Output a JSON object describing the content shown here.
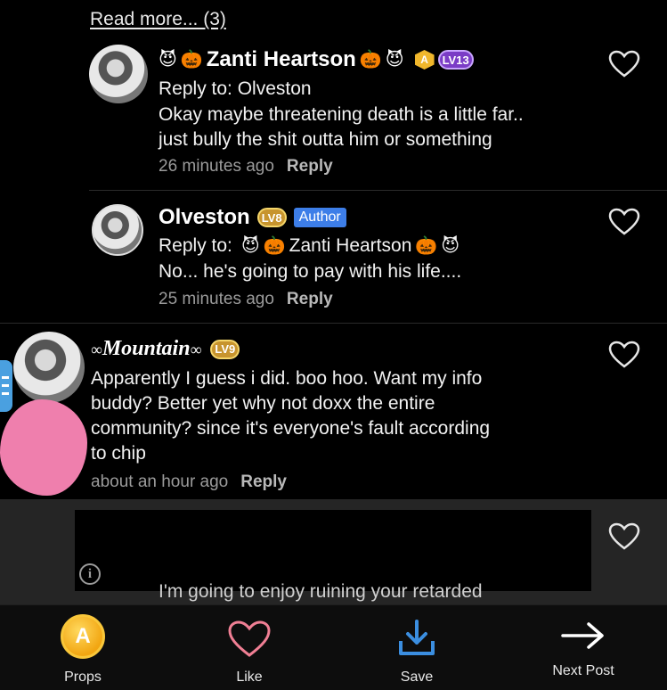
{
  "read_more": "Read more... (3)",
  "comments": [
    {
      "name": "Zanti Heartson",
      "level": "LV13",
      "reply_to_label": "Reply to:",
      "reply_to_name": "Olveston",
      "lines": [
        "Okay maybe threatening death is a little far..",
        "just bully the shit outta him or something"
      ],
      "time": "26 minutes ago",
      "reply": "Reply"
    },
    {
      "name": "Olveston",
      "level": "LV8",
      "author": "Author",
      "reply_to_label": "Reply to:",
      "reply_to_name": "Zanti Heartson",
      "lines": [
        "No... he's going to pay with his life...."
      ],
      "time": "25 minutes ago",
      "reply": "Reply"
    },
    {
      "name": "Mountain",
      "level": "LV9",
      "lines": [
        "Apparently I guess i did. boo hoo. Want my info",
        "buddy? Better yet why not doxx the entire",
        "community? since it's everyone's fault according",
        "to chip"
      ],
      "time": "about an hour ago",
      "reply": "Reply"
    }
  ],
  "partial_text": "I'm going to enjoy ruining your retarded",
  "bottom_bar": {
    "props": "Props",
    "like": "Like",
    "save": "Save",
    "next": "Next Post"
  },
  "colors": {
    "background": "#000000",
    "author_badge": "#3d7ee8",
    "like_heart": "#f07f94",
    "save_icon": "#3b8ee0",
    "props_coin": "#f2a612"
  }
}
